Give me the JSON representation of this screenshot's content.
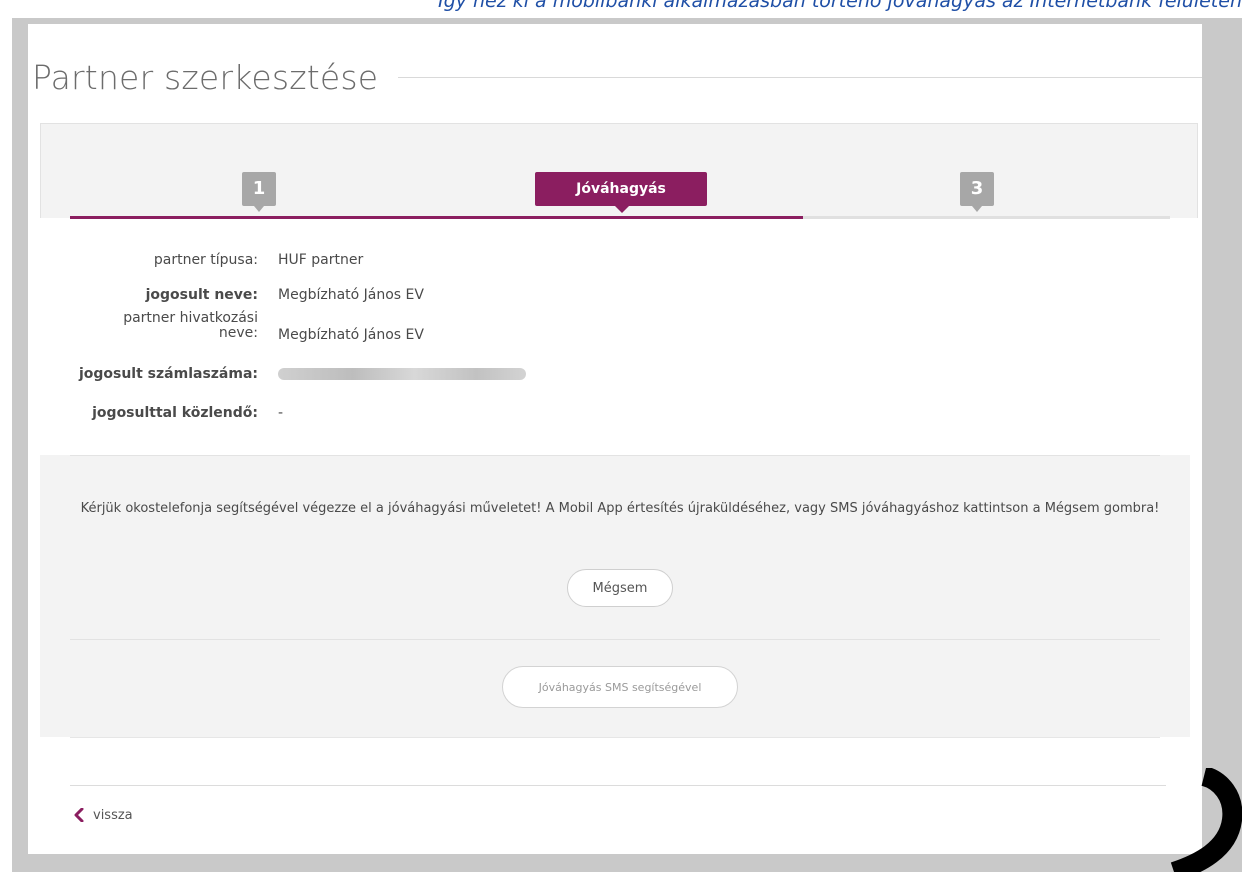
{
  "page": {
    "title": "Partner szerkesztése",
    "top_caption": "Így néz ki a mobilbanki alkalmazásban történő jóváhagyás az Internetbank felületén"
  },
  "wizard": {
    "step1_label": "1",
    "step2_label": "Jóváhagyás",
    "step3_label": "3",
    "active_step": 2,
    "progress_fraction": 0.667,
    "accent_color": "#8b1e60"
  },
  "details": [
    {
      "label": "partner típusa:",
      "value": "HUF partner"
    },
    {
      "label": "jogosult neve:",
      "value": "Megbízható János EV"
    },
    {
      "label": "partner hivatkozási\nneve:",
      "value": "Megbízható János EV"
    },
    {
      "label": "jogosult számlaszáma:",
      "value": ""
    },
    {
      "label": "jogosulttal közlendő:",
      "value": "-"
    }
  ],
  "approval": {
    "instruction": "Kérjük okostelefonja segítségével végezze el a jóváhagyási műveletet! A Mobil App értesítés újraküldéséhez, vagy SMS jóváhagyáshoz kattintson a Mégsem gombra!",
    "cancel_label": "Mégsem",
    "sms_label": "Jóváhagyás SMS segítségével"
  },
  "footer": {
    "back_label": "vissza"
  },
  "icons": {
    "back": "chevron-left-icon"
  }
}
